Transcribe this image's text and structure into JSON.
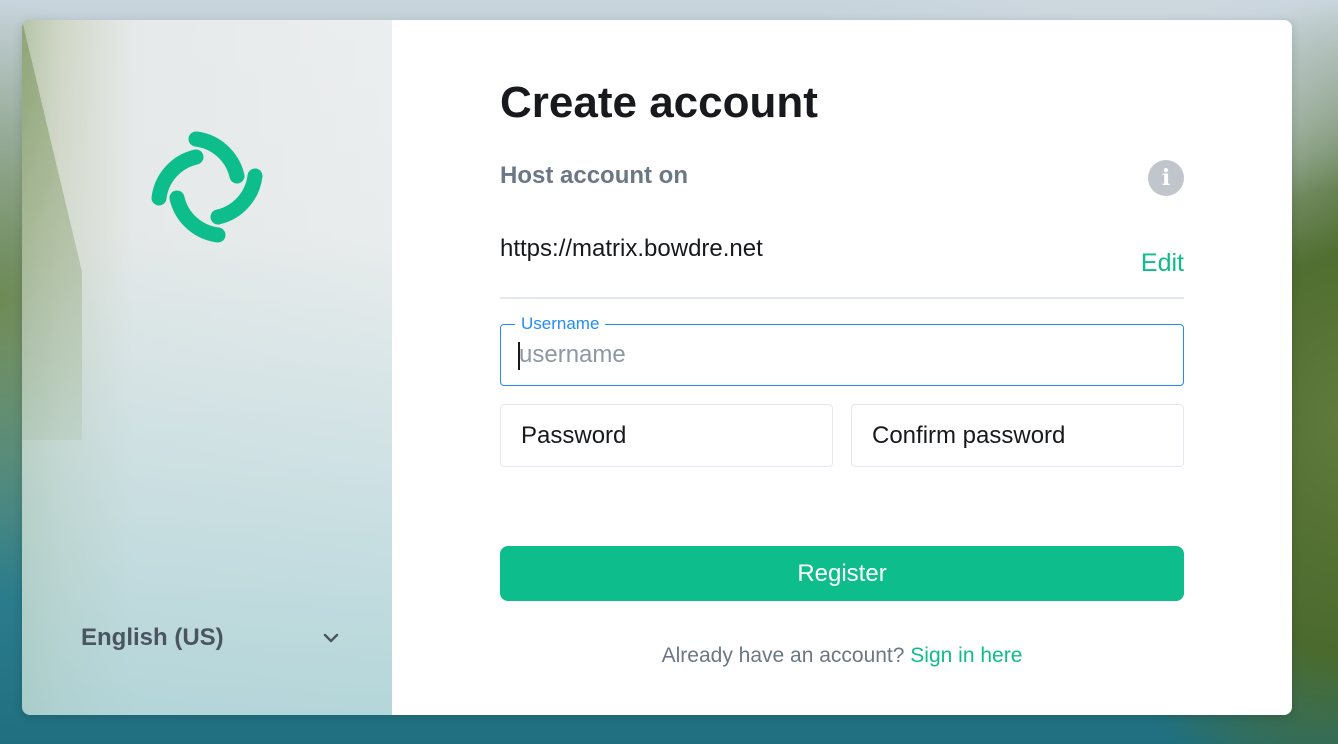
{
  "colors": {
    "accent": "#0dbd8b",
    "focus_blue": "#238cf5",
    "heading": "#17191c",
    "muted": "#6c7785",
    "info_icon": "#c1c6cd"
  },
  "sidebar": {
    "logo_icon": "element-logo-icon",
    "language": {
      "selected": "English (US)",
      "icon": "chevron-down-icon"
    }
  },
  "form": {
    "title": "Create account",
    "host_label": "Host account on",
    "info_icon": "info-icon",
    "host_url": "https://matrix.bowdre.net",
    "edit_label": "Edit",
    "username": {
      "label": "Username",
      "placeholder": "username",
      "value": ""
    },
    "password": {
      "placeholder": "Password",
      "value": ""
    },
    "confirm_password": {
      "placeholder": "Confirm password",
      "value": ""
    },
    "register_label": "Register",
    "signin_prompt": "Already have an account?",
    "signin_link": "Sign in here"
  }
}
